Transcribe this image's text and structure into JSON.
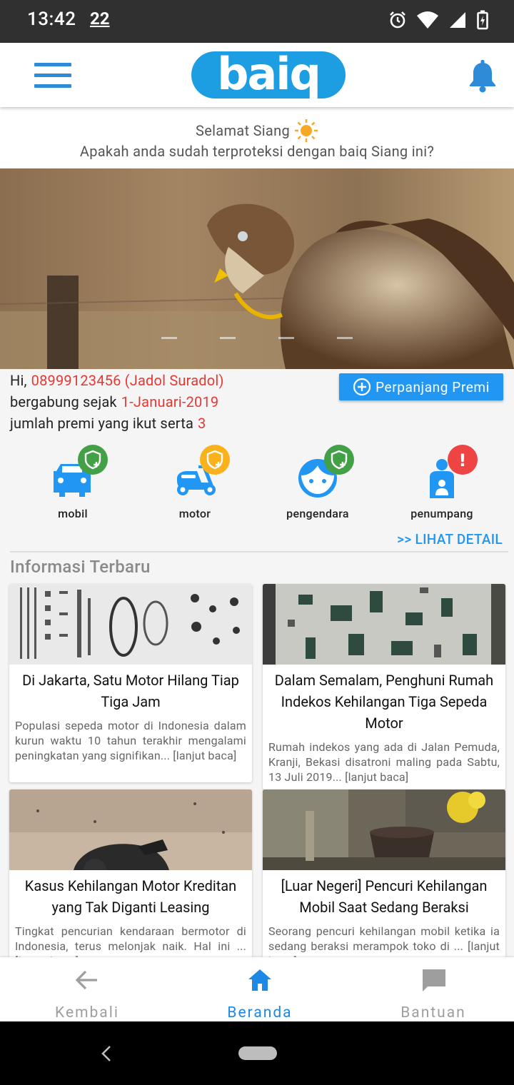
{
  "status_bar": {
    "time": "13:42",
    "notification": "22"
  },
  "app_bar": {
    "logo_text": "baiq"
  },
  "greeting": {
    "line1": "Selamat Siang",
    "line2": "Apakah anda sudah terproteksi dengan baiq Siang ini?"
  },
  "user": {
    "hi_label": "Hi,",
    "phone_name": "08999123456 (Jadol Suradol)",
    "joined_label": "bergabung sejak",
    "joined_date": "1-Januari-2019",
    "premi_label": "jumlah premi yang ikut serta",
    "premi_count": "3",
    "perpanjang_button": "Perpanjang Premi"
  },
  "coverage": [
    {
      "label": "mobil",
      "icon": "car-icon",
      "badge": "shield-plus",
      "badge_color": "#43a047"
    },
    {
      "label": "motor",
      "icon": "scooter-icon",
      "badge": "shield-plus",
      "badge_color": "#f9b21b"
    },
    {
      "label": "pengendara",
      "icon": "face-icon",
      "badge": "shield-plus",
      "badge_color": "#43a047"
    },
    {
      "label": "penumpang",
      "icon": "passenger-icon",
      "badge": "!",
      "badge_color": "#ef4444"
    }
  ],
  "detail_link": ">> LIHAT DETAIL",
  "news_section_title": "Informasi Terbaru",
  "news": [
    {
      "title": "Di Jakarta, Satu Motor Hilang Tiap Tiga Jam",
      "desc": "Populasi sepeda motor di Indonesia dalam kurun waktu 10 tahun terakhir mengalami peningkatan yang signifikan... [lanjut baca]"
    },
    {
      "title": "Dalam Semalam, Penghuni Rumah Indekos Kehilangan Tiga Sepeda Motor",
      "desc": "Rumah indekos yang ada di Jalan Pemuda, Kranji, Bekasi disatroni maling pada Sabtu, 13 Juli 2019... [lanjut baca]"
    },
    {
      "title": "Kasus Kehilangan Motor Kreditan yang Tak Diganti Leasing",
      "desc": "Tingkat pencurian kendaraan bermotor di Indonesia, terus melonjak naik. Hal ini ... [lanjut baca]"
    },
    {
      "title": "[Luar Negeri] Pencuri Kehilangan Mobil Saat Sedang Beraksi",
      "desc": "Seorang pencuri kehilangan mobil ketika ia sedang beraksi merampok toko di ... [lanjut baca]"
    }
  ],
  "bottom_nav": [
    {
      "label": "Kembali",
      "icon": "arrow-left-icon",
      "active": false
    },
    {
      "label": "Beranda",
      "icon": "home-icon",
      "active": true
    },
    {
      "label": "Bantuan",
      "icon": "chat-icon",
      "active": false
    }
  ],
  "colors": {
    "primary": "#2196f3",
    "accent_red": "#e53935",
    "logo_blue": "#1e9ee2"
  }
}
